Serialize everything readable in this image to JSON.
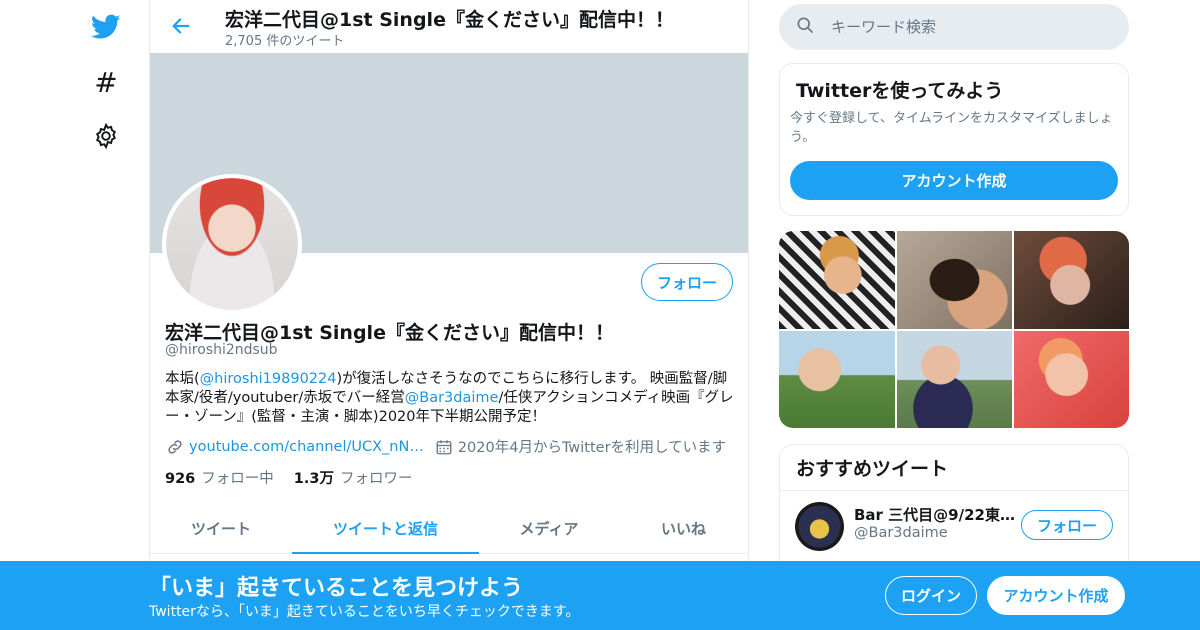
{
  "nav": {
    "icons": [
      "twitter-bird-icon",
      "hashtag-icon",
      "gear-icon"
    ],
    "hash_glyph": "#"
  },
  "header": {
    "title": "宏洋二代目@1st Single『金ください』配信中！！",
    "tweet_count": "2,705 件のツイート"
  },
  "profile": {
    "name": "宏洋二代目@1st Single『金ください』配信中！！",
    "handle": "@hiroshi2ndsub",
    "follow_label": "フォロー",
    "bio_part1": "本垢(",
    "bio_mention1": "@hiroshi19890224",
    "bio_part2": ")が復活しなさそうなのでこちらに移行します。 映画監督/脚本家/役者/youtuber/赤坂でバー経営",
    "bio_mention2": "@Bar3daime",
    "bio_part3": "/任侠アクションコメディ映画『グレー・ゾーン』(監督・主演・脚本)2020年下半期公開予定！",
    "link": "youtube.com/channel/UCX_nN…",
    "joined": "2020年4月からTwitterを利用しています",
    "following_count": "926",
    "following_label": "フォロー中",
    "followers_count": "1.3万",
    "followers_label": "フォロワー"
  },
  "tabs": [
    {
      "label": "ツイート"
    },
    {
      "label": "ツイートと返信"
    },
    {
      "label": "メディア"
    },
    {
      "label": "いいね"
    }
  ],
  "search": {
    "placeholder": "キーワード検索"
  },
  "signup_card": {
    "title": "Twitterを使ってみよう",
    "description": "今すぐ登録して、タイムラインをカスタマイズしましょう。",
    "button": "アカウント作成"
  },
  "recommend": {
    "title": "おすすめツイート",
    "name": "Bar 三代目@9/22東…",
    "handle": "@Bar3daime",
    "follow_label": "フォロー"
  },
  "bottom_bar": {
    "title": "「いま」起きていることを見つけよう",
    "subtitle": "Twitterなら、「いま」起きていることをいち早くチェックできます。",
    "login": "ログイン",
    "signup": "アカウント作成"
  },
  "colors": {
    "accent": "#1da1f2",
    "banner": "#ccd6dd",
    "secondary_text": "#657786"
  }
}
